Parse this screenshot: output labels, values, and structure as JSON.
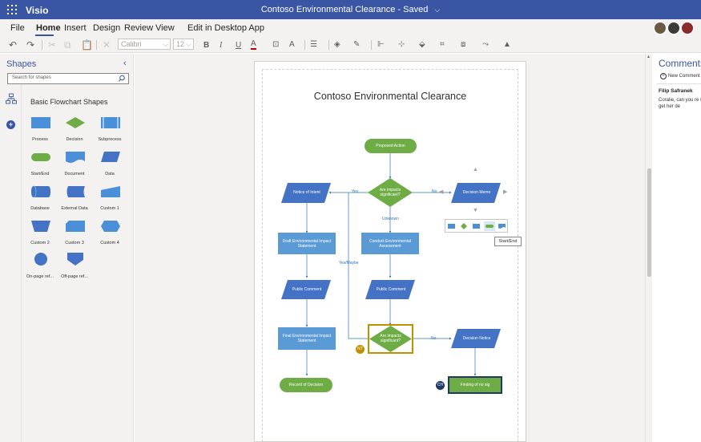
{
  "titlebar": {
    "app_name": "Visio",
    "document_title": "Contoso Environmental Clearance - Saved",
    "chevron": "⌵"
  },
  "menu": {
    "items": [
      "File",
      "Home",
      "Insert",
      "Design",
      "Review",
      "View",
      "Edit in Desktop App"
    ],
    "active": "Home"
  },
  "toolbar": {
    "font_name": "Calibri",
    "font_size": "12",
    "bold": "B",
    "italic": "I",
    "underline": "U",
    "font_color": "A",
    "grow_font": "A"
  },
  "shapes_panel": {
    "title": "Shapes",
    "collapse_icon": "‹",
    "search_placeholder": "Search for shapes",
    "stencil_name": "Basic Flowchart Shapes",
    "shapes": [
      {
        "label": "Process",
        "icon": "process-shape"
      },
      {
        "label": "Decision",
        "icon": "decision-shape"
      },
      {
        "label": "Subprocess",
        "icon": "subprocess-shape"
      },
      {
        "label": "Start/End",
        "icon": "start-end-shape"
      },
      {
        "label": "Document",
        "icon": "document-shape"
      },
      {
        "label": "Data",
        "icon": "data-shape"
      },
      {
        "label": "Database",
        "icon": "database-shape"
      },
      {
        "label": "External Data",
        "icon": "external-data-shape"
      },
      {
        "label": "Custom 1",
        "icon": "custom-1-shape"
      },
      {
        "label": "Custom 2",
        "icon": "custom-2-shape"
      },
      {
        "label": "Custom 3",
        "icon": "custom-3-shape"
      },
      {
        "label": "Custom 4",
        "icon": "custom-4-shape"
      },
      {
        "label": "On-page ref...",
        "icon": "on-page-reference-shape"
      },
      {
        "label": "Off-page ref...",
        "icon": "off-page-reference-shape"
      }
    ]
  },
  "diagram": {
    "title": "Contoso Environmental Clearance",
    "nodes": {
      "proposed_action": "Proposed Action",
      "are_impacts_1": "Are impacts significant?",
      "notice_of_intent": "Notice of Intent",
      "decision_memo": "Decision Memo",
      "draft_eis": "Draft Environmental Impact Statement",
      "conduct_ea": "Conduct Environmental Assessment",
      "public_comment_1": "Public Comment",
      "public_comment_2": "Public Comment",
      "final_eis": "Final Environmental Impact Statement",
      "are_impacts_2": "Are impacts significant?",
      "decision_notice": "Decision Notice",
      "record_of_decision": "Record of Decision",
      "finding_no_sig": "Finding of no sig"
    },
    "edge_labels": {
      "yes": "Yes",
      "no_1": "No",
      "unknown": "Unknown",
      "yes_maybe": "Yes/Maybe",
      "no_2": "No"
    },
    "badges": {
      "nt": "NT",
      "ch": "CH"
    },
    "tooltip": "Start/End"
  },
  "comments": {
    "title": "Comments",
    "new_comment": "New Comment",
    "author": "Filip Safranek",
    "body": "Coralie, can you re want to get her de"
  },
  "colors": {
    "brand": "#3955a3",
    "process_blue": "#5b9bd5",
    "data_blue": "#4472c4",
    "green": "#6eac45",
    "highlight_gold": "#bf9000",
    "dark_navy": "#1f3864"
  }
}
